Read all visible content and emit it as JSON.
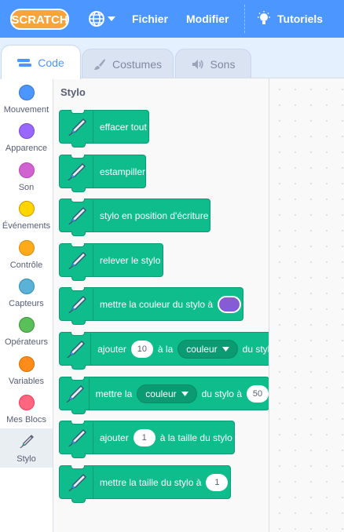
{
  "menubar": {
    "logo_text": "SCRATCH",
    "file": "Fichier",
    "edit": "Modifier",
    "tutorials": "Tutoriels",
    "colors": {
      "bar": "#4c97ff",
      "logo_orange": "#f9a33b"
    }
  },
  "tabs": [
    {
      "label": "Code",
      "active": true
    },
    {
      "label": "Costumes",
      "active": false
    },
    {
      "label": "Sons",
      "active": false
    }
  ],
  "categories": [
    {
      "label": "Mouvement",
      "color": "#4c97ff"
    },
    {
      "label": "Apparence",
      "color": "#9966ff"
    },
    {
      "label": "Son",
      "color": "#cf63cf"
    },
    {
      "label": "Événements",
      "color": "#ffd500"
    },
    {
      "label": "Contrôle",
      "color": "#ffab19"
    },
    {
      "label": "Capteurs",
      "color": "#5cb1d6"
    },
    {
      "label": "Opérateurs",
      "color": "#59c059"
    },
    {
      "label": "Variables",
      "color": "#ff8c1a"
    },
    {
      "label": "Mes Blocs",
      "color": "#ff6680"
    },
    {
      "label": "Stylo",
      "color": "pen-icon",
      "selected": true
    }
  ],
  "palette": {
    "section_title": "Stylo",
    "block_color": "#0fbd8c",
    "blocks": {
      "clear": "effacer tout",
      "stamp": "estampiller",
      "pen_down": "stylo en position d'écriture",
      "pen_up": "relever le stylo",
      "set_color_to": "mettre la couleur du stylo à",
      "set_color_swatch": "#855cd6",
      "change_by_prefix": "ajouter",
      "change_by_value": "10",
      "change_by_middle": "à la",
      "change_by_dropdown": "couleur",
      "change_by_suffix": "du stylo",
      "set_param_prefix": "mettre la",
      "set_param_dropdown": "couleur",
      "set_param_middle": "du stylo à",
      "set_param_value": "50",
      "change_size_prefix": "ajouter",
      "change_size_value": "1",
      "change_size_suffix": "à la taille du stylo",
      "set_size_prefix": "mettre la taille du stylo à",
      "set_size_value": "1"
    }
  }
}
